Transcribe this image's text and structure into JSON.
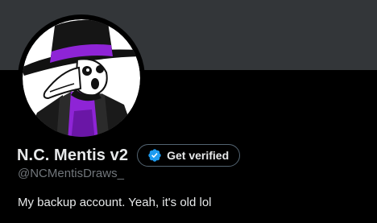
{
  "profile": {
    "display_name": "N.C. Mentis v2",
    "handle": "@NCMentisDraws_",
    "bio": "My backup account. Yeah, it's old lol",
    "verify_button_label": "Get verified"
  },
  "icons": {
    "verified": "verified-badge-icon",
    "avatar": "plague-doctor-character"
  },
  "colors": {
    "background": "#000000",
    "banner": "#333639",
    "text_primary": "#e7e9ea",
    "text_secondary": "#71767b",
    "badge_blue": "#1d9bf0",
    "avatar_accent": "#8e24d6"
  }
}
